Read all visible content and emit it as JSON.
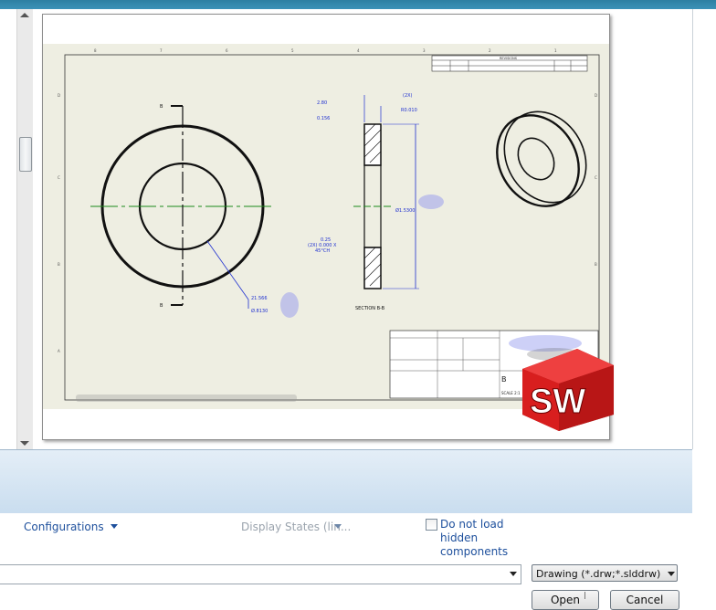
{
  "options": {
    "configurations_label": "Configurations",
    "display_states_label": "Display States (lin...",
    "hidden_components_label": "Do not load hidden components"
  },
  "file": {
    "name_value": "",
    "type_value": "Drawing (*.drw;*.slddrw)"
  },
  "buttons": {
    "open_label": "Open",
    "cancel_label": "Cancel"
  },
  "drawing": {
    "section_label": "SECTION B-B",
    "view_label_left": "B",
    "dim_outer": "Ø1.5300",
    "dim_inner_a": "21.566",
    "dim_inner_b": "Ø.8130",
    "dim_top_a": "2.80",
    "dim_top_b": "0.156",
    "dim_top_c": "(2X)",
    "dim_top_d": "R0.010",
    "dim_chamfer_a": "(2X) 0.000 X",
    "dim_chamfer_b": "45°CH",
    "dim_chamfer_c": "0.25",
    "title_revisions": "REVISIONS",
    "title_size": "B",
    "title_scale": "SCALE 2:1"
  },
  "brand": {
    "logo_text": "SW",
    "logo_color": "#d81e1e"
  },
  "colors": {
    "dimension_blue": "#1e2fd0",
    "centerline_green": "#1a8a1a",
    "sheet_bg": "#eeeee2",
    "link_blue": "#1d4f9c"
  }
}
